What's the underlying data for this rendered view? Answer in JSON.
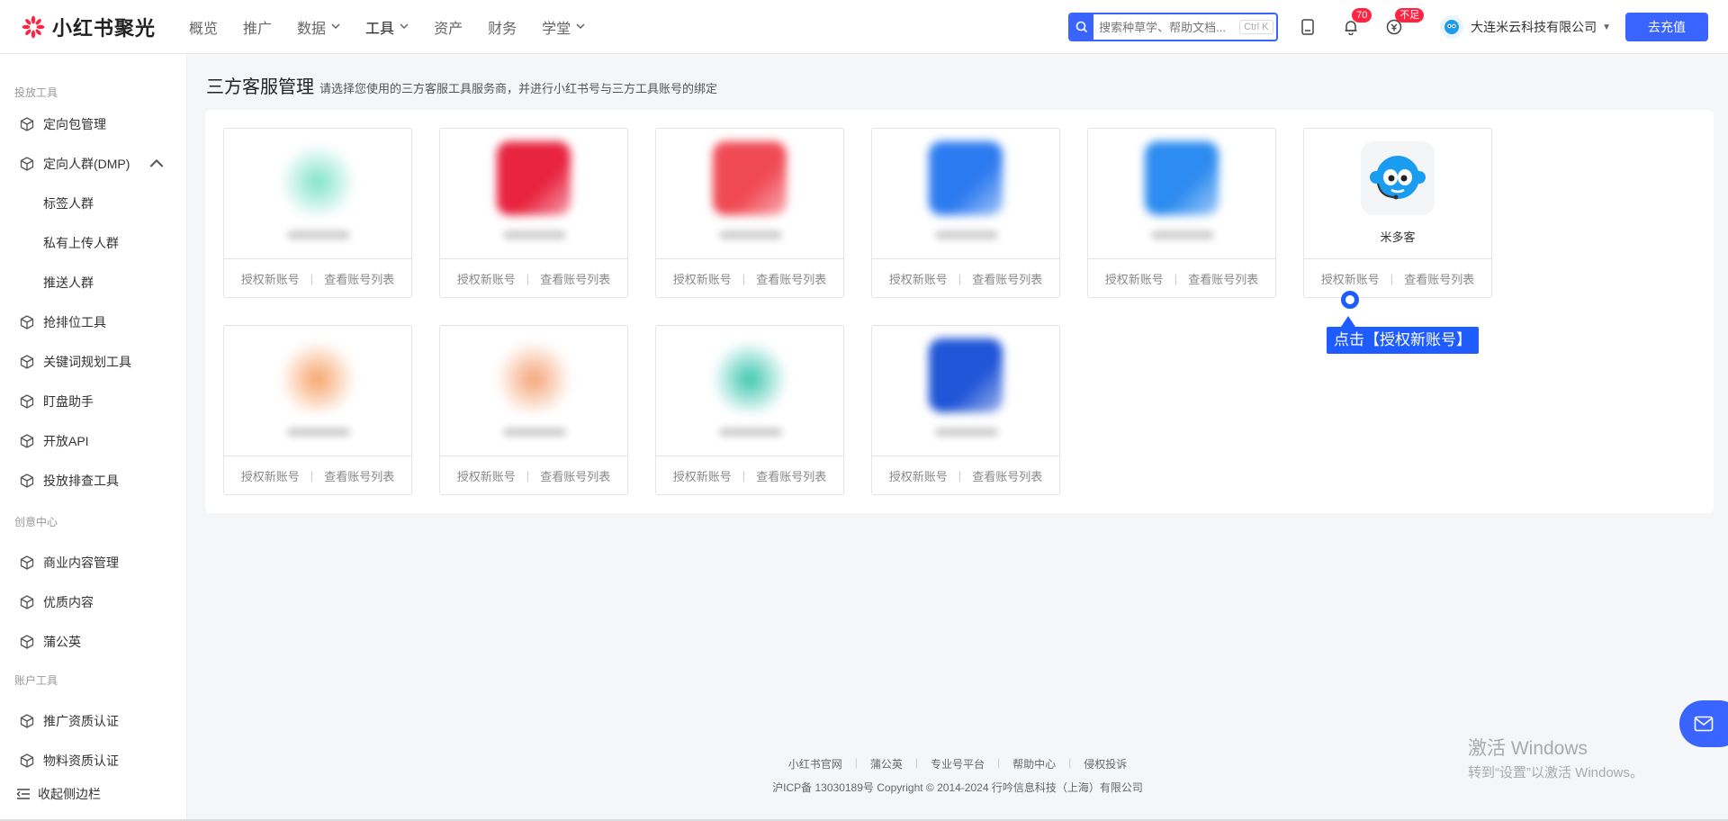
{
  "app": {
    "name": "小红书聚光"
  },
  "nav": [
    {
      "label": "概览",
      "chevron": false,
      "active": false
    },
    {
      "label": "推广",
      "chevron": false,
      "active": false
    },
    {
      "label": "数据",
      "chevron": true,
      "active": false
    },
    {
      "label": "工具",
      "chevron": true,
      "active": true
    },
    {
      "label": "资产",
      "chevron": false,
      "active": false
    },
    {
      "label": "财务",
      "chevron": false,
      "active": false
    },
    {
      "label": "学堂",
      "chevron": true,
      "active": false
    }
  ],
  "search": {
    "placeholder": "搜索种草学、帮助文档...",
    "shortcut": "Ctrl K"
  },
  "badges": {
    "notifications": "70",
    "balance": "不足"
  },
  "company": {
    "name": "大连米云科技有限公司"
  },
  "recharge_label": "去充值",
  "sidebar": {
    "sections": [
      {
        "title": "投放工具"
      },
      {
        "title": "创意中心"
      },
      {
        "title": "账户工具"
      }
    ],
    "items": [
      {
        "label": "定向包管理"
      },
      {
        "label": "定向人群(DMP)"
      },
      {
        "label": "抢排位工具"
      },
      {
        "label": "关键词规划工具"
      },
      {
        "label": "盯盘助手"
      },
      {
        "label": "开放API"
      },
      {
        "label": "投放排查工具"
      },
      {
        "label": "商业内容管理"
      },
      {
        "label": "优质内容"
      },
      {
        "label": "蒲公英"
      },
      {
        "label": "推广资质认证"
      },
      {
        "label": "物料资质认证"
      }
    ],
    "sub_items": [
      {
        "label": "标签人群"
      },
      {
        "label": "私有上传人群"
      },
      {
        "label": "推送人群"
      }
    ],
    "collapse_label": "收起侧边栏"
  },
  "page": {
    "title": "三方客服管理",
    "description": "请选择您使用的三方客服工具服务商，并进行小红书号与三方工具账号的绑定"
  },
  "card_actions": {
    "authorize": "授权新账号",
    "list": "查看账号列表"
  },
  "providers": [
    {
      "name": "",
      "color": "#7fe3c9",
      "blurred": true
    },
    {
      "name": "",
      "color": "#e8243f",
      "blurred": true
    },
    {
      "name": "",
      "color": "#f04b55",
      "blurred": true
    },
    {
      "name": "",
      "color": "#2d7bf0",
      "blurred": true
    },
    {
      "name": "",
      "color": "#2d8cf0",
      "blurred": true
    },
    {
      "name": "米多客",
      "color": "#1a9cf0",
      "blurred": false
    },
    {
      "name": "",
      "color": "#f7a46b",
      "blurred": true
    },
    {
      "name": "",
      "color": "#f5a477",
      "blurred": true
    },
    {
      "name": "",
      "color": "#3cc6b0",
      "blurred": true
    },
    {
      "name": "",
      "color": "#1f55d6",
      "blurred": true
    }
  ],
  "annotation": {
    "text": "点击【授权新账号】"
  },
  "footer": {
    "links": [
      "小红书官网",
      "蒲公英",
      "专业号平台",
      "帮助中心",
      "侵权投诉"
    ],
    "copyright": "沪ICP备 13030189号 Copyright © 2014-2024 行吟信息科技（上海）有限公司"
  },
  "watermark": {
    "line1": "激活 Windows",
    "line2": "转到“设置”以激活 Windows。"
  },
  "colors": {
    "accent": "#3a64ff",
    "badge": "#ff2442",
    "annotation": "#1f5cff"
  }
}
